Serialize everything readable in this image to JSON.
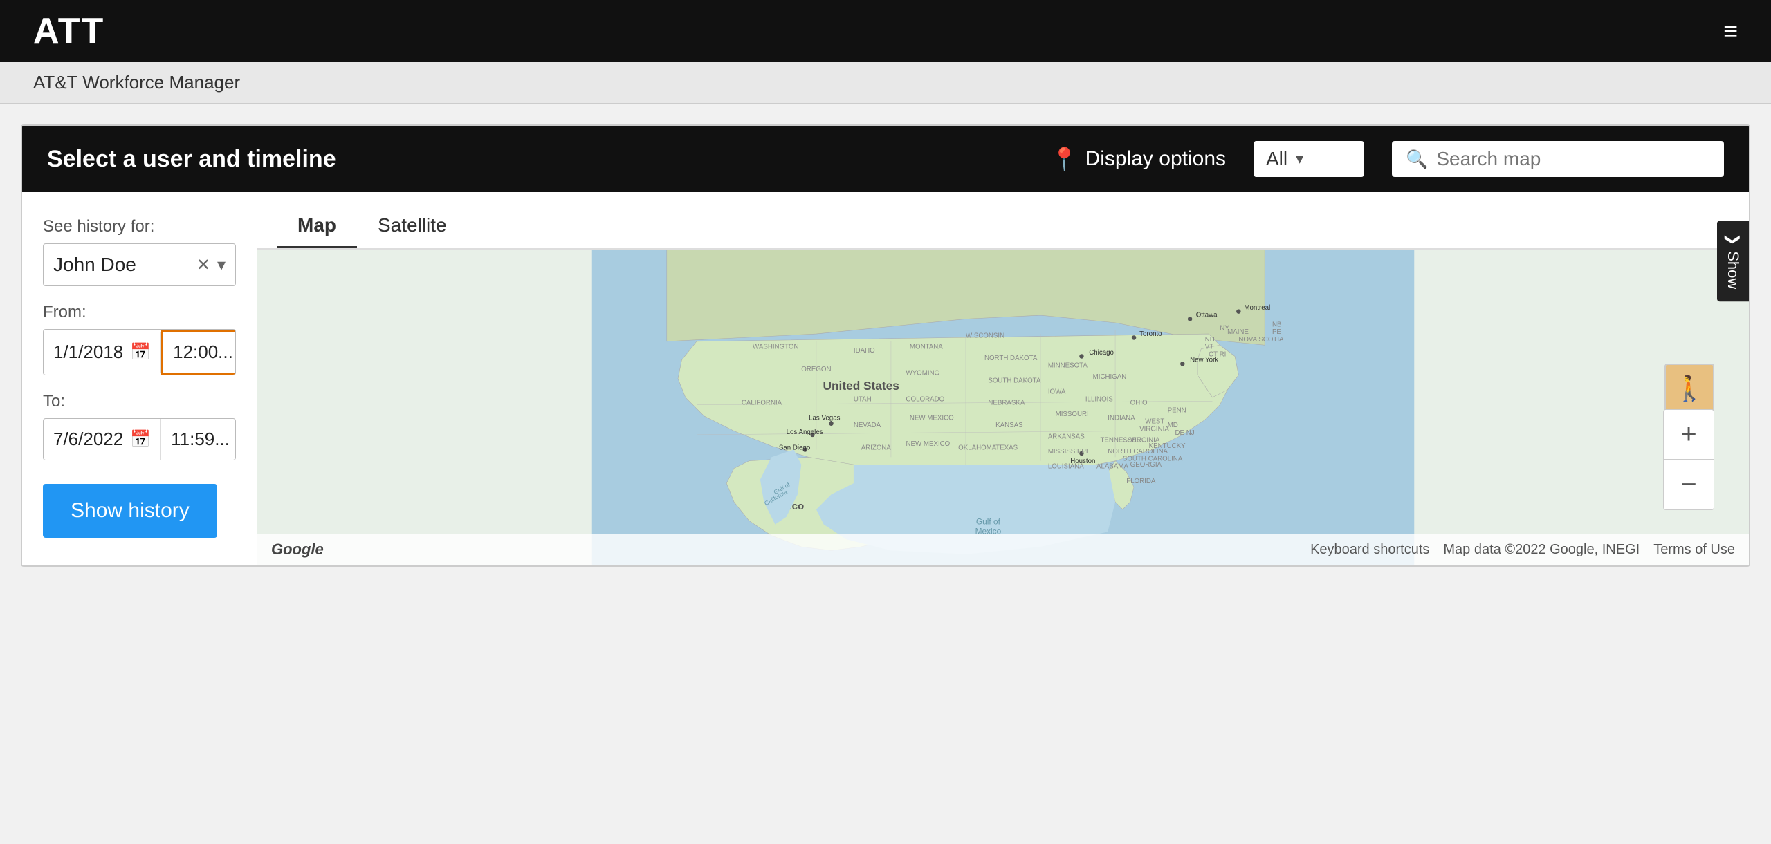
{
  "navbar": {
    "logo": "ATT",
    "menu_icon": "≡"
  },
  "breadcrumb": "AT&T Workforce Manager",
  "panel_header": {
    "title": "Select a user and timeline",
    "display_options_label": "Display options",
    "all_dropdown_value": "All",
    "search_map_placeholder": "Search map"
  },
  "show_sidebar": {
    "label": "Show",
    "arrow": "❯"
  },
  "left_panel": {
    "see_history_label": "See history for:",
    "user_name": "John Doe",
    "from_label": "From:",
    "from_date": "1/1/2018",
    "from_time": "12:00...",
    "to_label": "To:",
    "to_date": "7/6/2022",
    "to_time": "11:59...",
    "show_history_btn": "Show history"
  },
  "map": {
    "tab_map": "Map",
    "tab_satellite": "Satellite",
    "zoom_in": "+",
    "zoom_out": "−",
    "google_logo": "Google",
    "footer_links": [
      "Keyboard shortcuts",
      "Map data ©2022 Google, INEGI",
      "Terms of Use"
    ],
    "street_view_icon": "🚶"
  }
}
